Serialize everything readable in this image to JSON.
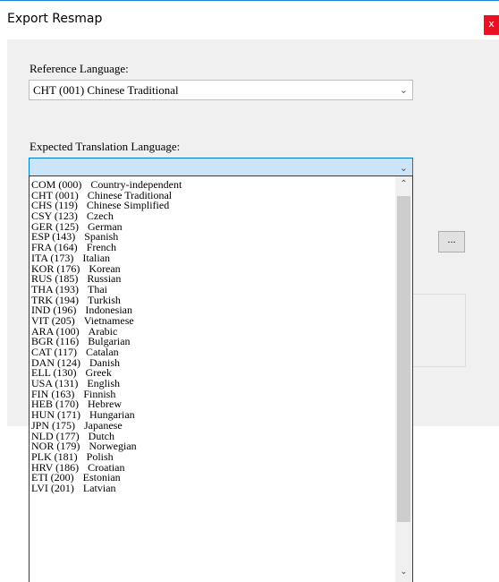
{
  "window": {
    "title": "Export Resmap",
    "close_glyph": "x"
  },
  "reference": {
    "label": "Reference Language:",
    "value": "CHT (001)   Chinese Traditional"
  },
  "expected": {
    "label": "Expected Translation Language:",
    "value": ""
  },
  "browse_label": "...",
  "icons": {
    "chevron": "chevron-down-icon",
    "scroll_up": "chevron-up-icon",
    "scroll_down": "chevron-down-icon"
  },
  "languages": [
    {
      "code": "COM (000)",
      "name": "Country-independent"
    },
    {
      "code": "CHT (001)",
      "name": "Chinese Traditional"
    },
    {
      "code": "CHS (119)",
      "name": "Chinese Simplified"
    },
    {
      "code": "CSY (123)",
      "name": "Czech"
    },
    {
      "code": "GER (125)",
      "name": "German"
    },
    {
      "code": "ESP (143)",
      "name": "Spanish"
    },
    {
      "code": "FRA (164)",
      "name": "French"
    },
    {
      "code": "ITA (173)",
      "name": "Italian"
    },
    {
      "code": "KOR (176)",
      "name": "Korean"
    },
    {
      "code": "RUS (185)",
      "name": "Russian"
    },
    {
      "code": "THA (193)",
      "name": "Thai"
    },
    {
      "code": "TRK (194)",
      "name": "Turkish"
    },
    {
      "code": "IND (196)",
      "name": "Indonesian"
    },
    {
      "code": "VIT (205)",
      "name": "Vietnamese"
    },
    {
      "code": "ARA (100)",
      "name": "Arabic"
    },
    {
      "code": "BGR (116)",
      "name": "Bulgarian"
    },
    {
      "code": "CAT (117)",
      "name": "Catalan"
    },
    {
      "code": "DAN (124)",
      "name": "Danish"
    },
    {
      "code": "ELL (130)",
      "name": "Greek"
    },
    {
      "code": "USA (131)",
      "name": "English"
    },
    {
      "code": "FIN (163)",
      "name": "Finnish"
    },
    {
      "code": "HEB (170)",
      "name": "Hebrew"
    },
    {
      "code": "HUN (171)",
      "name": "Hungarian"
    },
    {
      "code": "JPN (175)",
      "name": "Japanese"
    },
    {
      "code": "NLD (177)",
      "name": "Dutch"
    },
    {
      "code": "NOR (179)",
      "name": "Norwegian"
    },
    {
      "code": "PLK (181)",
      "name": "Polish"
    },
    {
      "code": "HRV (186)",
      "name": "Croatian"
    },
    {
      "code": "ETI (200)",
      "name": "Estonian"
    },
    {
      "code": "LVI (201)",
      "name": "Latvian"
    }
  ]
}
